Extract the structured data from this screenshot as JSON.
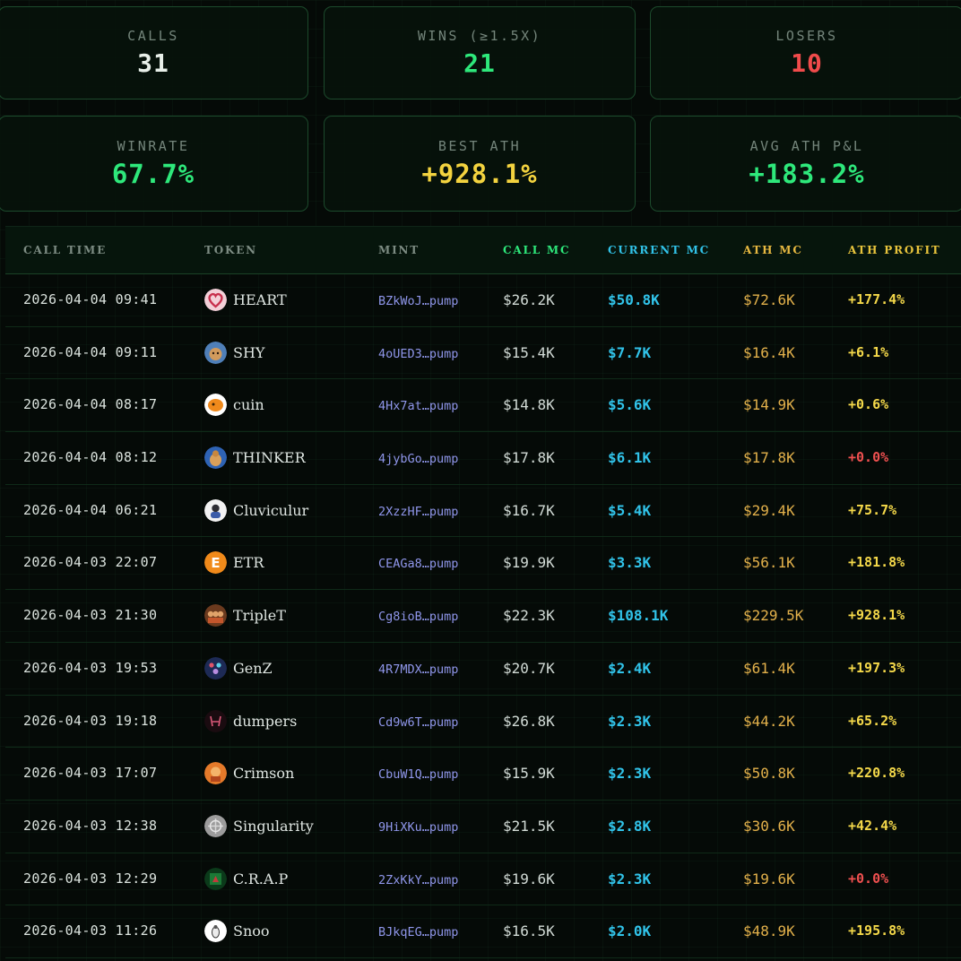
{
  "stats": {
    "calls": {
      "label": "CALLS",
      "value": "31",
      "color": "#e8efe9"
    },
    "wins": {
      "label": "WINS (≥1.5X)",
      "value": "21",
      "color": "#2ee87b"
    },
    "losers": {
      "label": "LOSERS",
      "value": "10",
      "color": "#f04b4b"
    },
    "winrate": {
      "label": "WINRATE",
      "value": "67.7%",
      "color": "#2ee87b"
    },
    "best_ath": {
      "label": "BEST ATH",
      "value": "+928.1%",
      "color": "#f3d33f"
    },
    "avg_ath": {
      "label": "AVG ATH P&L",
      "value": "+183.2%",
      "color": "#2ee87b"
    }
  },
  "table": {
    "headers": {
      "call_time": "CALL TIME",
      "token": "TOKEN",
      "mint": "MINT",
      "call_mc": "CALL MC",
      "current_mc": "CURRENT MC",
      "ath_mc": "ATH MC",
      "ath_profit": "ATH PROFIT"
    },
    "header_colors": {
      "call_time": "#7d8c83",
      "token": "#7d8c83",
      "mint": "#7d8c83",
      "call_mc": "#2ee87b",
      "current_mc": "#31c3e9",
      "ath_mc": "#e8b941",
      "ath_profit": "#e8c43c"
    },
    "rows": [
      {
        "time": "2026-04-04 09:41",
        "token": "HEART",
        "icon": "heart-icon",
        "mint": "BZkWoJ…pump",
        "call_mc": "$26.2K",
        "current_mc": "$50.8K",
        "ath_mc": "$72.6K",
        "profit": "+177.4%",
        "profit_positive": true
      },
      {
        "time": "2026-04-04 09:11",
        "token": "SHY",
        "icon": "shy-icon",
        "mint": "4oUED3…pump",
        "call_mc": "$15.4K",
        "current_mc": "$7.7K",
        "ath_mc": "$16.4K",
        "profit": "+6.1%",
        "profit_positive": true
      },
      {
        "time": "2026-04-04 08:17",
        "token": "cuin",
        "icon": "cuin-icon",
        "mint": "4Hx7at…pump",
        "call_mc": "$14.8K",
        "current_mc": "$5.6K",
        "ath_mc": "$14.9K",
        "profit": "+0.6%",
        "profit_positive": true
      },
      {
        "time": "2026-04-04 08:12",
        "token": "THINKER",
        "icon": "thinker-icon",
        "mint": "4jybGo…pump",
        "call_mc": "$17.8K",
        "current_mc": "$6.1K",
        "ath_mc": "$17.8K",
        "profit": "+0.0%",
        "profit_positive": false
      },
      {
        "time": "2026-04-04 06:21",
        "token": "Cluviculur",
        "icon": "cluviculur-icon",
        "mint": "2XzzHF…pump",
        "call_mc": "$16.7K",
        "current_mc": "$5.4K",
        "ath_mc": "$29.4K",
        "profit": "+75.7%",
        "profit_positive": true
      },
      {
        "time": "2026-04-03 22:07",
        "token": "ETR",
        "icon": "etr-icon",
        "mint": "CEAGa8…pump",
        "call_mc": "$19.9K",
        "current_mc": "$3.3K",
        "ath_mc": "$56.1K",
        "profit": "+181.8%",
        "profit_positive": true
      },
      {
        "time": "2026-04-03 21:30",
        "token": "TripleT",
        "icon": "triplet-icon",
        "mint": "Cg8ioB…pump",
        "call_mc": "$22.3K",
        "current_mc": "$108.1K",
        "ath_mc": "$229.5K",
        "profit": "+928.1%",
        "profit_positive": true
      },
      {
        "time": "2026-04-03 19:53",
        "token": "GenZ",
        "icon": "genz-icon",
        "mint": "4R7MDX…pump",
        "call_mc": "$20.7K",
        "current_mc": "$2.4K",
        "ath_mc": "$61.4K",
        "profit": "+197.3%",
        "profit_positive": true
      },
      {
        "time": "2026-04-03 19:18",
        "token": "dumpers",
        "icon": "dumpers-icon",
        "mint": "Cd9w6T…pump",
        "call_mc": "$26.8K",
        "current_mc": "$2.3K",
        "ath_mc": "$44.2K",
        "profit": "+65.2%",
        "profit_positive": true
      },
      {
        "time": "2026-04-03 17:07",
        "token": "Crimson",
        "icon": "crimson-icon",
        "mint": "CbuW1Q…pump",
        "call_mc": "$15.9K",
        "current_mc": "$2.3K",
        "ath_mc": "$50.8K",
        "profit": "+220.8%",
        "profit_positive": true
      },
      {
        "time": "2026-04-03 12:38",
        "token": "Singularity",
        "icon": "singularity-icon",
        "mint": "9HiXKu…pump",
        "call_mc": "$21.5K",
        "current_mc": "$2.8K",
        "ath_mc": "$30.6K",
        "profit": "+42.4%",
        "profit_positive": true
      },
      {
        "time": "2026-04-03 12:29",
        "token": "C.R.A.P",
        "icon": "crap-icon",
        "mint": "2ZxKkY…pump",
        "call_mc": "$19.6K",
        "current_mc": "$2.3K",
        "ath_mc": "$19.6K",
        "profit": "+0.0%",
        "profit_positive": false
      },
      {
        "time": "2026-04-03 11:26",
        "token": "Snoo",
        "icon": "snoo-icon",
        "mint": "BJkqEG…pump",
        "call_mc": "$16.5K",
        "current_mc": "$2.0K",
        "ath_mc": "$48.9K",
        "profit": "+195.8%",
        "profit_positive": true
      }
    ]
  }
}
